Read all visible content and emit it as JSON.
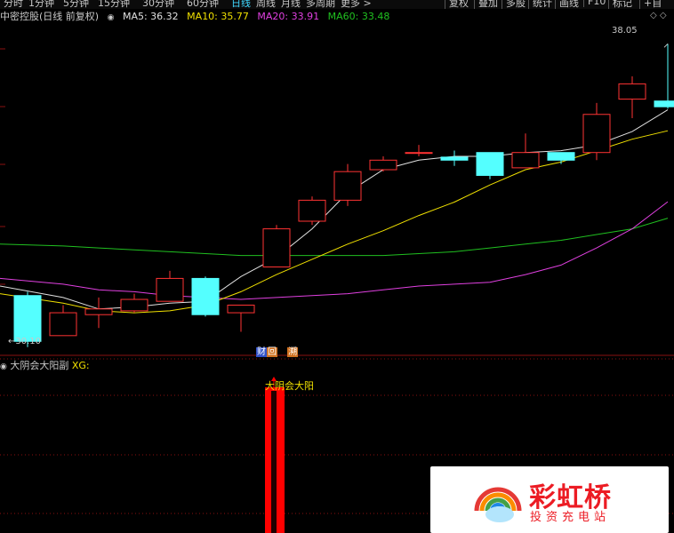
{
  "toolbar": {
    "periods": [
      "分时",
      "1分钟",
      "5分钟",
      "15分钟",
      "30分钟",
      "60分钟",
      "日线",
      "周线",
      "月线",
      "多周期",
      "更多 >"
    ],
    "active_period": "日线",
    "buttons": [
      "复权",
      "叠加",
      "多股",
      "统计",
      "画线",
      "F10",
      "标记",
      "+自"
    ]
  },
  "legend": {
    "title": "中密控股(日线 前复权)",
    "ma": [
      {
        "label": "MA5: 36.32",
        "color": "#e0e0e0"
      },
      {
        "label": "MA10: 35.77",
        "color": "#f0e000"
      },
      {
        "label": "MA20: 33.91",
        "color": "#e040e0"
      },
      {
        "label": "MA60: 33.48",
        "color": "#20c020"
      }
    ]
  },
  "annotations": {
    "high_label": "38.05",
    "low_label": "30.10",
    "badge_finance": "财",
    "badge_finance2": "回",
    "badge_other": "溯"
  },
  "sub_panel": {
    "legend_name": "大阴会大阳副",
    "legend_suffix": "XG:",
    "signal_text": "大阴会大阳"
  },
  "watermark": {
    "title": "彩虹桥",
    "subtitle": "投资充电站"
  },
  "colors": {
    "up": "#ff3333",
    "down": "#54ffff",
    "signal": "#ff0000",
    "bg": "#000000"
  },
  "chart_data": [
    {
      "type": "candlestick",
      "title": "中密控股(日线 前复权)",
      "candles": [
        {
          "o": 31.45,
          "h": 31.55,
          "l": 30.1,
          "c": 30.25
        },
        {
          "o": 30.4,
          "h": 31.2,
          "l": 30.4,
          "c": 31.0
        },
        {
          "o": 30.95,
          "h": 31.4,
          "l": 30.6,
          "c": 31.1
        },
        {
          "o": 31.05,
          "h": 31.5,
          "l": 31.0,
          "c": 31.35
        },
        {
          "o": 31.3,
          "h": 32.1,
          "l": 31.3,
          "c": 31.9
        },
        {
          "o": 31.9,
          "h": 31.95,
          "l": 30.9,
          "c": 30.95
        },
        {
          "o": 31.0,
          "h": 31.15,
          "l": 30.5,
          "c": 31.2
        },
        {
          "o": 32.2,
          "h": 33.3,
          "l": 32.2,
          "c": 33.2
        },
        {
          "o": 33.4,
          "h": 34.05,
          "l": 33.3,
          "c": 33.95
        },
        {
          "o": 33.95,
          "h": 34.9,
          "l": 33.8,
          "c": 34.7
        },
        {
          "o": 34.75,
          "h": 35.1,
          "l": 34.7,
          "c": 35.0
        },
        {
          "o": 35.2,
          "h": 35.4,
          "l": 35.1,
          "c": 35.2
        },
        {
          "o": 35.08,
          "h": 35.25,
          "l": 34.85,
          "c": 35.0
        },
        {
          "o": 35.2,
          "h": 35.2,
          "l": 34.5,
          "c": 34.6
        },
        {
          "o": 34.8,
          "h": 35.7,
          "l": 34.8,
          "c": 35.2
        },
        {
          "o": 35.2,
          "h": 35.2,
          "l": 34.9,
          "c": 35.0
        },
        {
          "o": 35.2,
          "h": 36.5,
          "l": 35.0,
          "c": 36.2
        },
        {
          "o": 36.6,
          "h": 37.2,
          "l": 36.1,
          "c": 37.0
        },
        {
          "o": 36.55,
          "h": 38.05,
          "l": 36.35,
          "c": 36.4
        }
      ],
      "ma5": [
        31.7,
        31.4,
        31.1,
        31.15,
        31.25,
        31.3,
        31.95,
        32.45,
        33.2,
        34.15,
        34.75,
        35.0,
        35.1,
        35.1,
        35.2,
        35.25,
        35.4,
        35.75,
        36.32
      ],
      "ma10": [
        31.5,
        31.25,
        31.05,
        31.0,
        31.05,
        31.2,
        31.55,
        32.0,
        32.4,
        32.8,
        33.15,
        33.55,
        33.9,
        34.35,
        34.75,
        34.95,
        35.25,
        35.55,
        35.77
      ],
      "ma20": [
        31.9,
        31.75,
        31.6,
        31.55,
        31.45,
        31.4,
        31.35,
        31.4,
        31.45,
        31.5,
        31.6,
        31.7,
        31.75,
        31.8,
        32.0,
        32.25,
        32.7,
        33.2,
        33.91
      ],
      "ma60": [
        32.8,
        32.75,
        32.7,
        32.65,
        32.6,
        32.55,
        32.5,
        32.5,
        32.5,
        32.5,
        32.5,
        32.55,
        32.6,
        32.7,
        32.8,
        32.9,
        33.05,
        33.2,
        33.48
      ],
      "ylim": [
        30.0,
        38.5
      ]
    },
    {
      "type": "bar",
      "title": "大阴会大阳副",
      "values": [
        0,
        0,
        0,
        0,
        0,
        0,
        0,
        1,
        0,
        0,
        0,
        0,
        0,
        0,
        0,
        0,
        0,
        0,
        0
      ],
      "ylim": [
        0,
        1
      ]
    }
  ]
}
